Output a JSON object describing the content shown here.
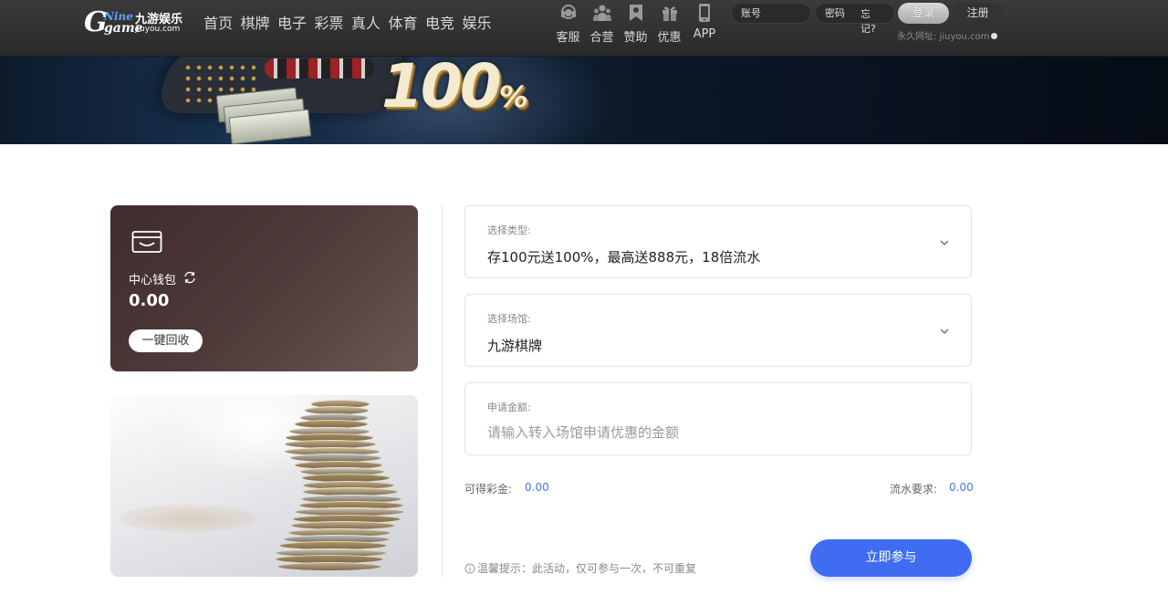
{
  "header": {
    "logo": {
      "nine": "Nine",
      "game": "game",
      "brand_cn": "九游娱乐",
      "domain": "jiuyou.com"
    },
    "nav": [
      "首页",
      "棋牌",
      "电子",
      "彩票",
      "真人",
      "体育",
      "电竞",
      "娱乐"
    ],
    "icon_nav": [
      {
        "label": "客服",
        "icon": "headset-icon"
      },
      {
        "label": "合营",
        "icon": "partners-icon"
      },
      {
        "label": "赞助",
        "icon": "sponsor-icon"
      },
      {
        "label": "优惠",
        "icon": "gift-icon"
      },
      {
        "label": "APP",
        "icon": "phone-icon"
      }
    ],
    "login": {
      "account_placeholder": "账号",
      "password_placeholder": "密码",
      "forgot": "忘记?",
      "login_button": "登录",
      "register_button": "注册",
      "permanent_url": "永久网址: jiuyou.com"
    }
  },
  "banner": {
    "percent_text": "100",
    "percent_sign": "%"
  },
  "wallet": {
    "title": "中心钱包",
    "balance": "0.00",
    "recall_button": "一键回收"
  },
  "form": {
    "type": {
      "label": "选择类型:",
      "value": "存100元送100%，最高送888元，18倍流水"
    },
    "venue": {
      "label": "选择场馆:",
      "value": "九游棋牌"
    },
    "amount": {
      "label": "申请金额:",
      "placeholder": "请输入转入场馆申请优惠的金额",
      "value": ""
    },
    "bonus_label": "可得彩金:",
    "bonus_value": "0.00",
    "turnover_label": "流水要求:",
    "turnover_value": "0.00",
    "tip": "温馨提示：此活动，仅可参与一次，不可重复",
    "submit_button": "立即参与"
  },
  "colors": {
    "accent": "#3f6cf0",
    "stat_value": "#4a74e8",
    "wallet_bg": "#4d3a39",
    "header_bg": "#333333"
  }
}
